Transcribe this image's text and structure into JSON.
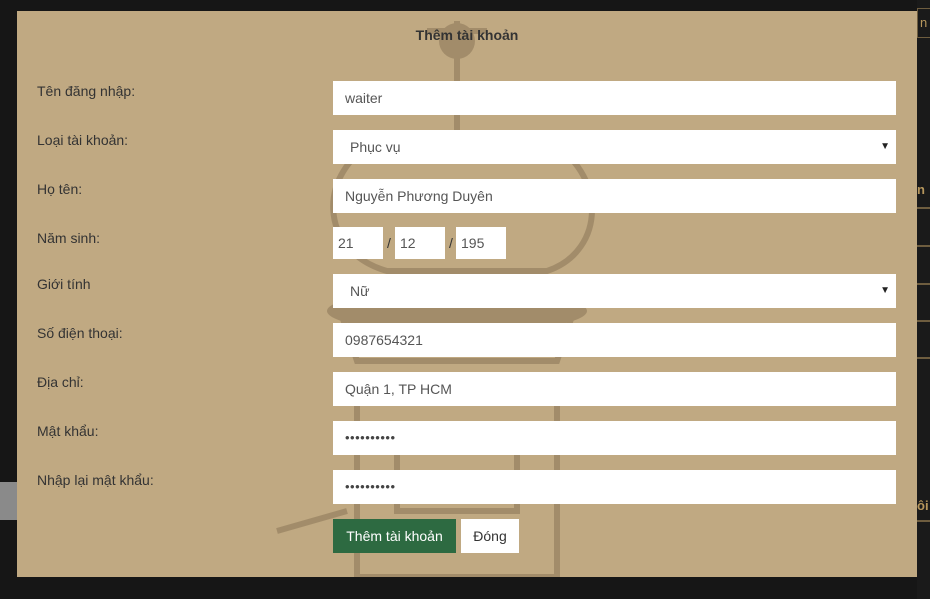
{
  "modal": {
    "title": "Thêm tài khoản"
  },
  "form": {
    "username": {
      "label": "Tên đăng nhập:",
      "value": "waiter"
    },
    "account_type": {
      "label": "Loại tài khoản:",
      "value": "Phục vụ"
    },
    "full_name": {
      "label": "Họ tên:",
      "value": "Nguyễn Phương Duyên"
    },
    "birth_year": {
      "label": "Năm sinh:",
      "day": "21",
      "month": "12",
      "year": "195",
      "separator": "/"
    },
    "gender": {
      "label": "Giới tính",
      "value": "Nữ"
    },
    "phone": {
      "label": "Số điện thoại:",
      "value": "0987654321"
    },
    "address": {
      "label": "Địa chỉ:",
      "value": "Quận 1, TP HCM"
    },
    "password": {
      "label": "Mật khẩu:",
      "value": "••••••••••"
    },
    "confirm_password": {
      "label": "Nhập lại mật khẩu:",
      "value": "••••••••••"
    }
  },
  "buttons": {
    "submit_label": "Thêm tài khoản",
    "close_label": "Đóng"
  },
  "background_fragments": {
    "tab_text": "n",
    "side_text": "ôi"
  },
  "colors": {
    "modal_bg": "#c0a982",
    "primary_button": "#2d6a41",
    "page_bg": "#161616"
  }
}
